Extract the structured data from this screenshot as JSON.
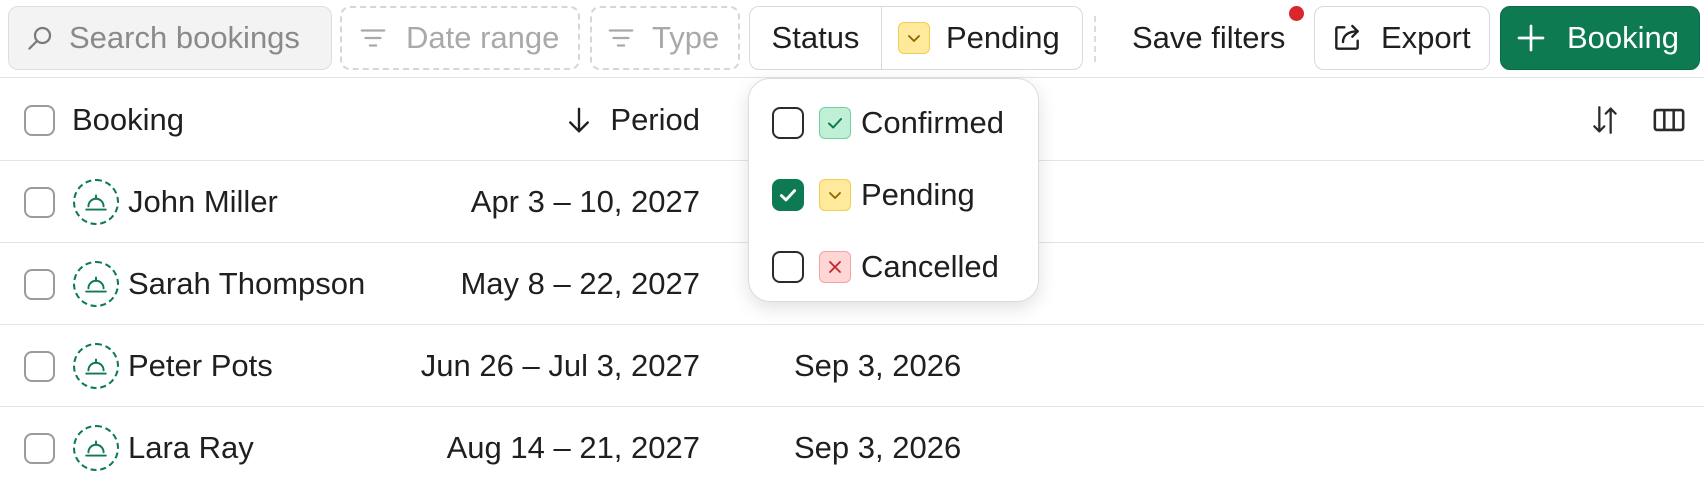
{
  "toolbar": {
    "search_placeholder": "Search bookings",
    "date_range_label": "Date range",
    "type_label": "Type",
    "status_label": "Status",
    "status_value": "Pending",
    "save_filters_label": "Save filters",
    "export_label": "Export",
    "booking_label": "Booking"
  },
  "table": {
    "columns": {
      "booking": "Booking",
      "period": "Period"
    },
    "rows": [
      {
        "name": "John Miller",
        "period": "Apr 3 – 10, 2027",
        "created": ""
      },
      {
        "name": "Sarah Thompson",
        "period": "May 8 – 22, 2027",
        "created": ""
      },
      {
        "name": "Peter Pots",
        "period": "Jun 26 – Jul 3, 2027",
        "created": "Sep 3, 2026"
      },
      {
        "name": "Lara Ray",
        "period": "Aug 14 – 21, 2027",
        "created": "Sep 3, 2026"
      }
    ]
  },
  "status_dropdown": {
    "options": [
      {
        "label": "Confirmed",
        "checked": false,
        "icon": "check-icon",
        "badge_bg": "#bff0d6",
        "badge_border": "#6fd3a1",
        "badge_fg": "#0d7a52"
      },
      {
        "label": "Pending",
        "checked": true,
        "icon": "clock-icon",
        "badge_bg": "#ffe99a",
        "badge_border": "#f2cc55",
        "badge_fg": "#8a6500"
      },
      {
        "label": "Cancelled",
        "checked": false,
        "icon": "x-icon",
        "badge_bg": "#ffd6d6",
        "badge_border": "#f3a3a3",
        "badge_fg": "#c4262b"
      }
    ]
  },
  "colors": {
    "brand": "#0d7a52",
    "notification": "#d9262c"
  }
}
